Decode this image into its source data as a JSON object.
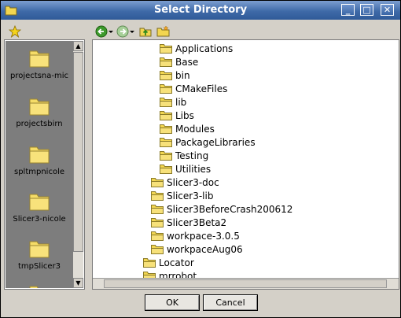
{
  "window": {
    "title": "Select Directory",
    "controls": {
      "minimize": "_",
      "maximize": "□",
      "close": "✕"
    }
  },
  "places_panel": {
    "items": [
      {
        "label": "projectsna-mic"
      },
      {
        "label": "projectsbirn"
      },
      {
        "label": "spltmpnicole"
      },
      {
        "label": "Slicer3-nicole"
      },
      {
        "label": "tmpSlicer3"
      }
    ]
  },
  "tree": {
    "rows": [
      {
        "name": "Applications",
        "level": 3
      },
      {
        "name": "Base",
        "level": 3
      },
      {
        "name": "bin",
        "level": 3
      },
      {
        "name": "CMakeFiles",
        "level": 3
      },
      {
        "name": "lib",
        "level": 3
      },
      {
        "name": "Libs",
        "level": 3
      },
      {
        "name": "Modules",
        "level": 3
      },
      {
        "name": "PackageLibraries",
        "level": 3
      },
      {
        "name": "Testing",
        "level": 3
      },
      {
        "name": "Utilities",
        "level": 3
      },
      {
        "name": "Slicer3-doc",
        "level": 2
      },
      {
        "name": "Slicer3-lib",
        "level": 2
      },
      {
        "name": "Slicer3BeforeCrash200612",
        "level": 2
      },
      {
        "name": "Slicer3Beta2",
        "level": 2
      },
      {
        "name": "workpace-3.0.5",
        "level": 2
      },
      {
        "name": "workpaceAug06",
        "level": 2
      },
      {
        "name": "Locator",
        "level": 1
      },
      {
        "name": "mrrobot",
        "level": 1
      }
    ]
  },
  "buttons": {
    "ok": "OK",
    "cancel": "Cancel"
  },
  "colors": {
    "title_bar": "#3f6aa8",
    "places_bg": "#7d7d7d",
    "folder": "#f2d650"
  }
}
